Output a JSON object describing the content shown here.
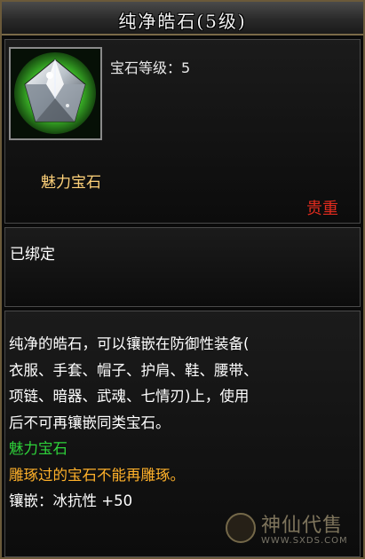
{
  "header": {
    "title": "纯净皓石(5级)"
  },
  "item": {
    "icon": "white-gem-icon",
    "level_label": "宝石等级：5",
    "name": "魅力宝石",
    "rarity": "贵重",
    "bind_status": "已绑定"
  },
  "description": {
    "lines": [
      "纯净的皓石，可以镶嵌在防御性装备(",
      "衣服、手套、帽子、护肩、鞋、腰带、",
      "项链、暗器、武魂、七情刃)上，使用",
      "后不可再镶嵌同类宝石。"
    ],
    "category": "魅力宝石",
    "note": "雕琢过的宝石不能再雕琢。",
    "effect": "镶嵌：冰抗性 +50"
  },
  "watermark": {
    "text": "神仙代售",
    "url": "WWW.SXDS.COM"
  },
  "colors": {
    "rarity": "#e02b1e",
    "name": "#ffd27a",
    "category": "#2ed33a",
    "note": "#ffb12a"
  }
}
